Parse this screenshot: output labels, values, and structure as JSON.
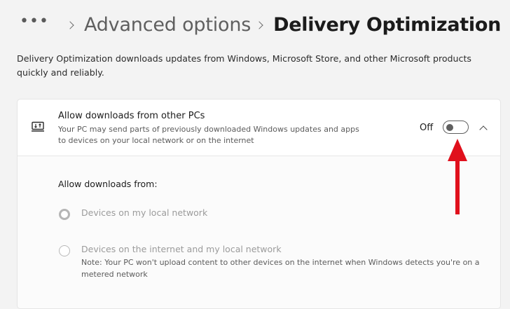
{
  "breadcrumb": {
    "more_label": "•••",
    "parent": "Advanced options",
    "current": "Delivery Optimization"
  },
  "description": "Delivery Optimization downloads updates from Windows, Microsoft Store, and other Microsoft products quickly and reliably.",
  "setting": {
    "icon": "network-transfer-icon",
    "title": "Allow downloads from other PCs",
    "subtitle": "Your PC may send parts of previously downloaded Windows updates and apps to devices on your local network or on the internet",
    "toggle_state_label": "Off",
    "toggle_on": false,
    "expanded": true
  },
  "downloads_from": {
    "label": "Allow downloads from:",
    "options": [
      {
        "label": "Devices on my local network",
        "selected": true,
        "enabled": false
      },
      {
        "label": "Devices on the internet and my local network",
        "selected": false,
        "enabled": false,
        "note": "Note: Your PC won't upload content to other devices on the internet when Windows detects you're on a metered network"
      }
    ]
  },
  "annotation": {
    "arrow_color": "#e0101c"
  }
}
